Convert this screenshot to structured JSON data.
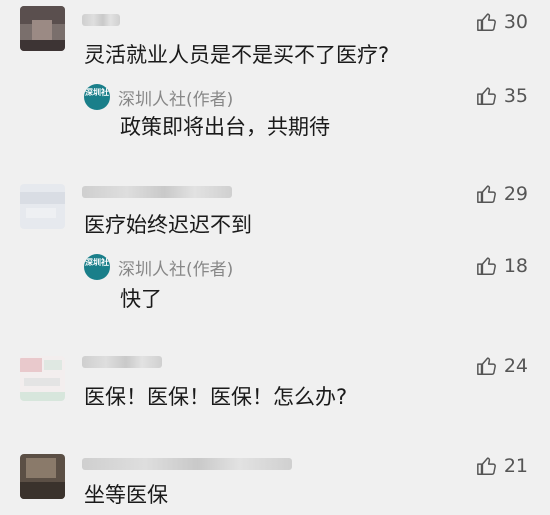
{
  "comments": [
    {
      "text": "灵活就业人员是不是买不了医疗?",
      "likes": "30",
      "reply": {
        "author": "深圳人社(作者)",
        "text": "政策即将出台，共期待",
        "likes": "35"
      }
    },
    {
      "text": "医疗始终迟迟不到",
      "likes": "29",
      "reply": {
        "author": "深圳人社(作者)",
        "text": "快了",
        "likes": "18"
      }
    },
    {
      "text": "医保！医保！医保！怎么办?",
      "likes": "24"
    },
    {
      "text": "坐等医保",
      "likes": "21"
    }
  ],
  "author_logo_text": "深圳社",
  "icons": {
    "like": "thumbs-up-icon",
    "author_avatar": "shenzhen-hrss-logo-icon"
  },
  "colors": {
    "background": "#f0f0f0",
    "author_logo": "#1a7f8a"
  }
}
